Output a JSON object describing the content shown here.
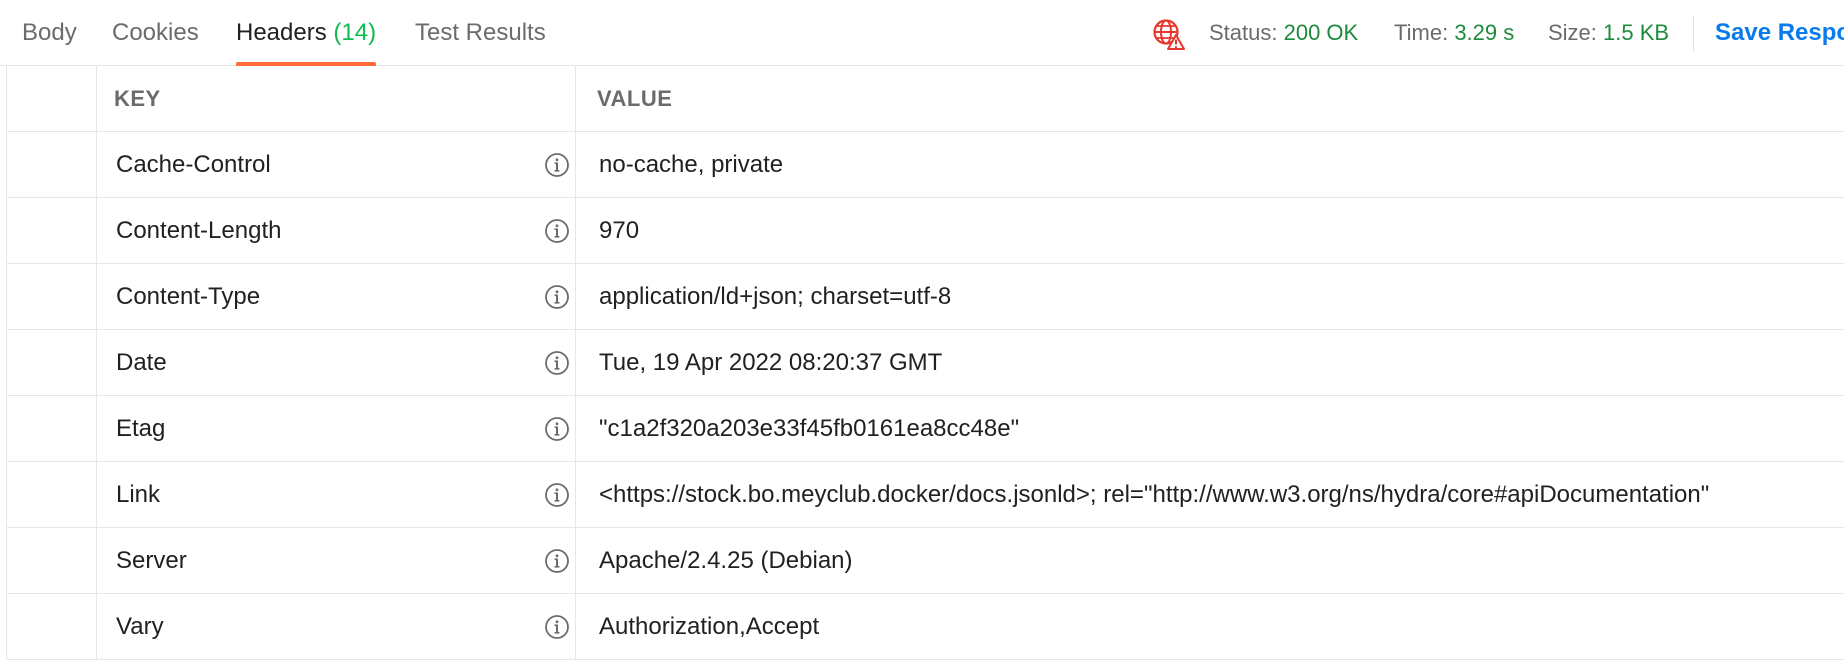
{
  "tabs": {
    "body": "Body",
    "cookies": "Cookies",
    "headers": "Headers",
    "headers_count": "(14)",
    "tests": "Test Results"
  },
  "status": {
    "status_label": "Status:",
    "status_value": "200 OK",
    "time_label": "Time:",
    "time_value": "3.29 s",
    "size_label": "Size:",
    "size_value": "1.5 KB",
    "save_label": "Save Respo",
    "globe_icon": "globe-warning-icon",
    "value_color": "#1d8a3c",
    "warning_color": "#e8372c"
  },
  "table": {
    "key_header": "KEY",
    "value_header": "VALUE",
    "rows": [
      {
        "key": "Cache-Control",
        "value": "no-cache, private"
      },
      {
        "key": "Content-Length",
        "value": "970"
      },
      {
        "key": "Content-Type",
        "value": "application/ld+json; charset=utf-8"
      },
      {
        "key": "Date",
        "value": "Tue, 19 Apr 2022 08:20:37 GMT"
      },
      {
        "key": "Etag",
        "value": "\"c1a2f320a203e33f45fb0161ea8cc48e\""
      },
      {
        "key": "Link",
        "value": "<https://stock.bo.meyclub.docker/docs.jsonld>; rel=\"http://www.w3.org/ns/hydra/core#apiDocumentation\""
      },
      {
        "key": "Server",
        "value": "Apache/2.4.25 (Debian)"
      },
      {
        "key": "Vary",
        "value": "Authorization,Accept"
      }
    ]
  },
  "accent_color": "#ff6c37",
  "link_color": "#097bed"
}
